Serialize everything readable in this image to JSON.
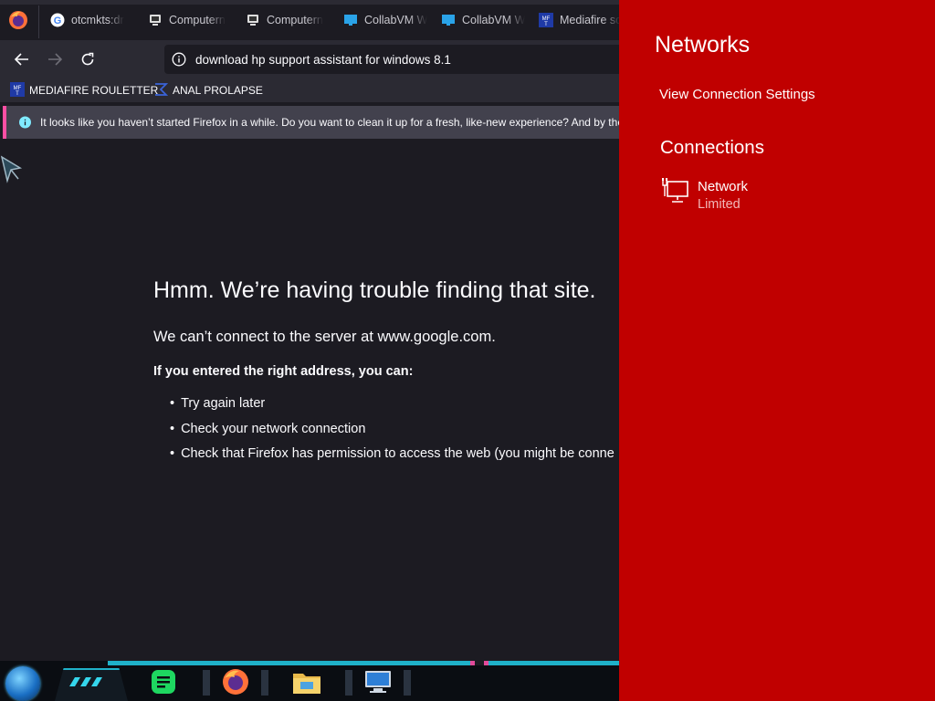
{
  "browser": {
    "tabs": [
      {
        "label": "otcmkts:dr",
        "icon": "google-icon"
      },
      {
        "label": "Computern",
        "icon": "computer-hope-icon"
      },
      {
        "label": "Computern",
        "icon": "computer-hope-icon"
      },
      {
        "label": "CollabVM W",
        "icon": "monitor-icon"
      },
      {
        "label": "CollabVM W",
        "icon": "monitor-icon"
      },
      {
        "label": "Mediafire sc",
        "icon": "mediafire-icon"
      }
    ],
    "url": "download hp support assistant for windows 8.1",
    "bookmarks": [
      {
        "label": "MEDIAFIRE ROULETTER",
        "icon": "mediafire-icon"
      },
      {
        "label": "ANAL PROLAPSE",
        "icon": "sigma-icon"
      }
    ],
    "notice": "It looks like you haven’t started Firefox in a while. Do you want to clean it up for a fresh, like-new experience? And by the",
    "error": {
      "title": "Hmm. We’re having trouble finding that site.",
      "description": "We can’t connect to the server at www.google.com.",
      "hint": "If you entered the right address, you can:",
      "suggestions": [
        "Try again later",
        "Check your network connection",
        "Check that Firefox has permission to access the web (you might be conne"
      ]
    }
  },
  "taskbar": {
    "items": [
      "start-orb",
      "task-view-icon",
      "notes-app-icon",
      "firefox-icon",
      "file-explorer-icon",
      "remote-desktop-icon"
    ]
  },
  "networks": {
    "title": "Networks",
    "settings_link": "View Connection Settings",
    "connections_heading": "Connections",
    "connection": {
      "name": "Network",
      "status": "Limited",
      "icon": "wired-network-icon"
    },
    "colors": {
      "background": "#c00000",
      "status_text": "#f2b8b8"
    }
  },
  "colors": {
    "browser_bg": "#1c1b22",
    "toolbar_bg": "#2b2a33",
    "notice_accent": "#ff4fa3",
    "taskbar_accent": "#1fb1c9"
  }
}
